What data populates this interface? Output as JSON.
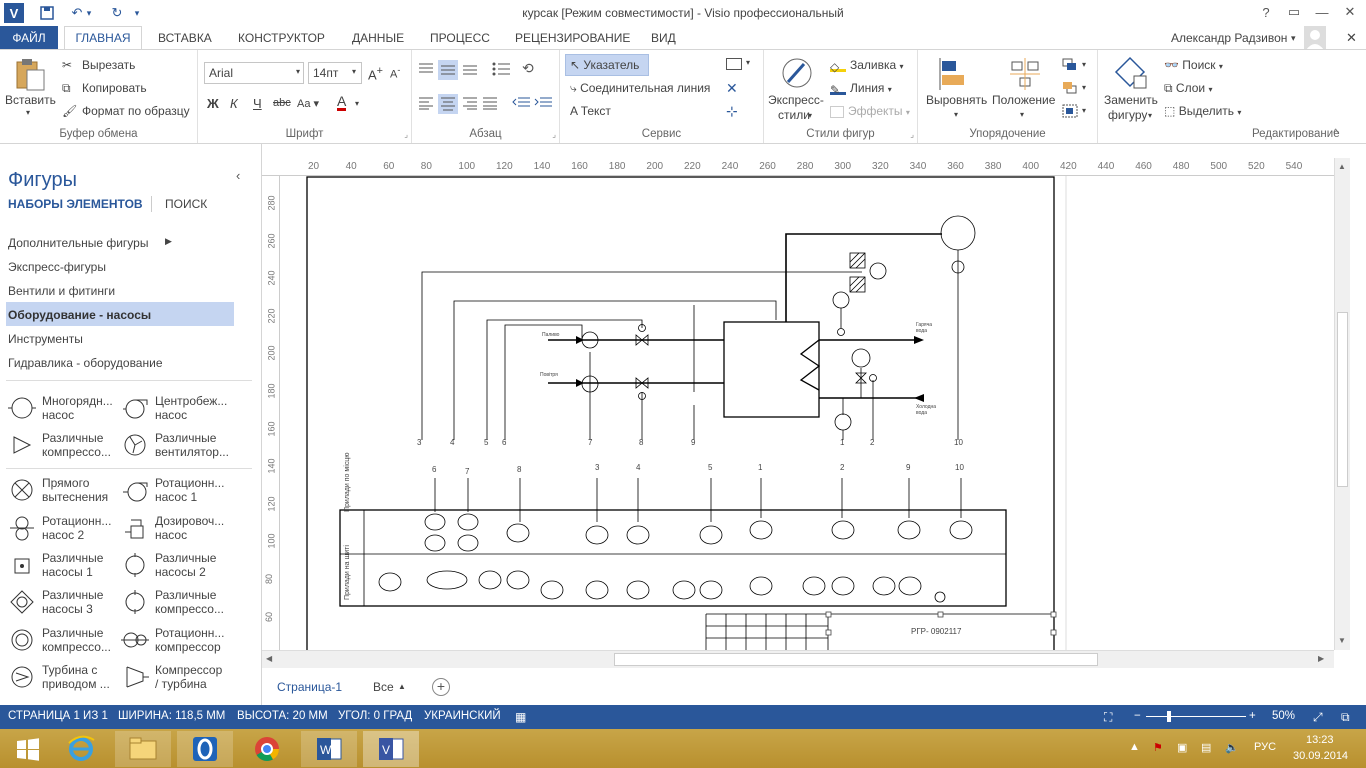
{
  "window": {
    "title": "курсак  [Режим совместимости] -  Visio профессиональный",
    "app_icon": "V",
    "user_name": "Александр Радзивон"
  },
  "tabs": [
    {
      "label": "ФАЙЛ"
    },
    {
      "label": "ГЛАВНАЯ"
    },
    {
      "label": "ВСТАВКА"
    },
    {
      "label": "КОНСТРУКТОР"
    },
    {
      "label": "ДАННЫЕ"
    },
    {
      "label": "ПРОЦЕСС"
    },
    {
      "label": "РЕЦЕНЗИРОВАНИЕ"
    },
    {
      "label": "ВИД"
    }
  ],
  "ribbon": {
    "clipboard": {
      "paste": "Вставить",
      "cut": "Вырезать",
      "copy": "Копировать",
      "format_painter": "Формат по образцу",
      "group": "Буфер обмена"
    },
    "font": {
      "name": "Arial",
      "size": "14пт",
      "group": "Шрифт"
    },
    "paragraph": {
      "group": "Абзац"
    },
    "tools": {
      "pointer": "Указатель",
      "connector": "Соединительная линия",
      "text": "Текст",
      "group": "Сервис"
    },
    "styles": {
      "express": "Экспресс-",
      "express2": "стили",
      "fill": "Заливка",
      "line": "Линия",
      "effects": "Эффекты",
      "group": "Стили фигур"
    },
    "arrange": {
      "align": "Выровнять",
      "position": "Положение",
      "group": "Упорядочение"
    },
    "editing": {
      "change": "Заменить",
      "change2": "фигуру",
      "find": "Поиск",
      "layers": "Слои",
      "select": "Выделить",
      "group": "Редактирование"
    }
  },
  "shapes_panel": {
    "title": "Фигуры",
    "stencils_tab": "НАБОРЫ ЭЛЕМЕНТОВ",
    "search_tab": "ПОИСК",
    "stencils": [
      {
        "label": "Дополнительные фигуры"
      },
      {
        "label": "Экспресс-фигуры"
      },
      {
        "label": "Вентили и фитинги"
      },
      {
        "label": "Оборудование - насосы"
      },
      {
        "label": "Инструменты"
      },
      {
        "label": "Гидравлика - оборудование"
      }
    ],
    "shapes": [
      {
        "l1": "Многорядн...",
        "l2": "насос"
      },
      {
        "l1": "Центробеж...",
        "l2": "насос"
      },
      {
        "l1": "Различные",
        "l2": "компрессо..."
      },
      {
        "l1": "Различные",
        "l2": "вентилятор..."
      },
      {
        "l1": "Прямого",
        "l2": "вытеснения"
      },
      {
        "l1": "Ротационн...",
        "l2": "насос 1"
      },
      {
        "l1": "Ротационн...",
        "l2": "насос 2"
      },
      {
        "l1": "Дозировоч...",
        "l2": "насос"
      },
      {
        "l1": "Различные",
        "l2": "насосы 1"
      },
      {
        "l1": "Различные",
        "l2": "насосы 2"
      },
      {
        "l1": "Различные",
        "l2": "насосы 3"
      },
      {
        "l1": "Различные",
        "l2": "компрессо..."
      },
      {
        "l1": "Различные",
        "l2": "компрессо..."
      },
      {
        "l1": "Ротационн...",
        "l2": "компрессор"
      },
      {
        "l1": "Турбина с",
        "l2": "приводом ..."
      },
      {
        "l1": "Компрессор",
        "l2": "/ турбина"
      }
    ]
  },
  "ruler_top": [
    "20",
    "40",
    "60",
    "80",
    "100",
    "120",
    "140",
    "160",
    "180",
    "200",
    "220",
    "240",
    "260",
    "280",
    "300",
    "320",
    "340",
    "360",
    "380",
    "400",
    "420",
    "440",
    "460",
    "480",
    "500",
    "520",
    "540"
  ],
  "ruler_left": [
    "280",
    "260",
    "240",
    "220",
    "200",
    "180",
    "160",
    "140",
    "120",
    "100",
    "80",
    "60"
  ],
  "diagram": {
    "lines_labels": [
      "3",
      "4",
      "5",
      "6",
      "7",
      "8",
      "9",
      "1",
      "2",
      "10"
    ],
    "inputs": [
      "Паливо",
      "Повітря"
    ],
    "outputs": [
      "Гаряча вода",
      "Холодна вода"
    ],
    "row_top": "Прилади по місцю",
    "row_bottom": "Прилади на щиті",
    "stamp": "РГР- 0902117",
    "top_nums": [
      "6",
      "7",
      "8",
      "3",
      "4",
      "5",
      "1",
      "2",
      "9",
      "10"
    ]
  },
  "page_tabs": {
    "page": "Страница-1",
    "all": "Все"
  },
  "status": {
    "page": "СТРАНИЦА 1 ИЗ 1",
    "width": "ШИРИНА: 118,5 ММ",
    "height": "ВЫСОТА: 20 ММ",
    "angle": "УГОЛ: 0 ГРАД",
    "lang": "УКРАИНСКИЙ",
    "zoom": "50%"
  },
  "taskbar": {
    "lang": "РУС",
    "time": "13:23",
    "date": "30.09.2014"
  }
}
